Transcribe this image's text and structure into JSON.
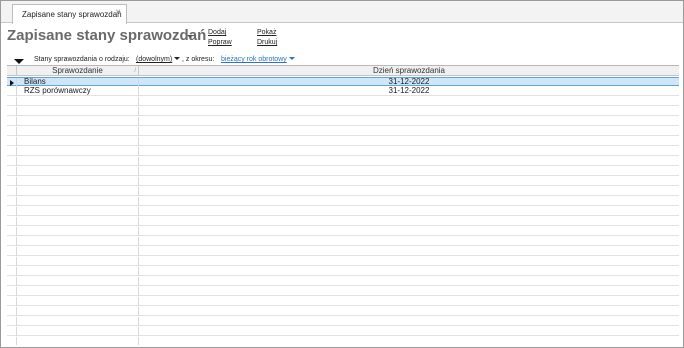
{
  "tab": {
    "label": "Zapisane stany sprawozdań",
    "close_symbol": "×"
  },
  "header": {
    "title": "Zapisane stany sprawozdań",
    "actions": {
      "add": "Dodaj",
      "edit": "Popraw",
      "show": "Pokaż",
      "print": "Drukuj"
    }
  },
  "filter": {
    "kind_label": "Stany sprawozdania o rodzaju:",
    "kind_value": "(dowolnym)",
    "period_label": ", z okresu:",
    "period_value": "bieżący rok obrotowy"
  },
  "grid": {
    "columns": {
      "name": "Sprawozdanie",
      "date": "Dzień sprawozdania"
    },
    "rows": [
      {
        "name": "Bilans",
        "date": "31-12-2022",
        "selected": true
      },
      {
        "name": "RZS porównawczy",
        "date": "31-12-2022",
        "selected": false
      }
    ]
  },
  "colors": {
    "selection_bg": "#cfe6fa",
    "selection_border": "#62a4dc",
    "link_blue": "#2a72c8",
    "title_gray": "#6a6a6a"
  }
}
